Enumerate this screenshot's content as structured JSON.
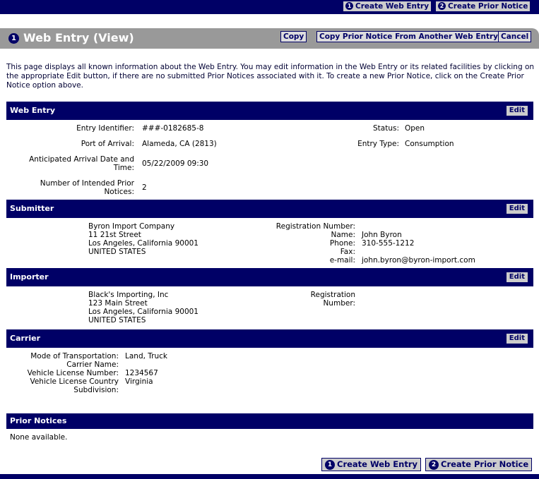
{
  "top_nav": {
    "create_web_entry": "Create Web Entry",
    "create_prior_notice": "Create Prior Notice",
    "step1": "1",
    "step2": "2"
  },
  "header": {
    "step": "1",
    "title": "Web Entry (View)",
    "copy": "Copy",
    "copy_prior_notice": "Copy Prior Notice From Another Web Entry",
    "cancel": "Cancel"
  },
  "intro": "This page displays all known information about the Web Entry. You may edit information in the Web Entry or its related facilities by clicking on the appropriate Edit button, if there are no submitted Prior Notices associated with it. To create a new Prior Notice, click on the Create Prior Notice option above.",
  "edit_label": "Edit",
  "web_entry": {
    "title": "Web Entry",
    "entry_identifier_label": "Entry Identifier:",
    "entry_identifier": "###-0182685-8",
    "status_label": "Status:",
    "status": "Open",
    "port_label": "Port of Arrival:",
    "port": "Alameda, CA (2813)",
    "entry_type_label": "Entry Type:",
    "entry_type": "Consumption",
    "arrival_label_1": "Anticipated Arrival Date and",
    "arrival_label_2": "Time:",
    "arrival": "05/22/2009 09:30",
    "notices_label_1": "Number of Intended Prior",
    "notices_label_2": "Notices:",
    "notices": "2"
  },
  "submitter": {
    "title": "Submitter",
    "address": [
      "Byron Import Company",
      "11 21st Street",
      "Los Angeles, California  90001",
      "UNITED STATES"
    ],
    "labels": [
      "Registration Number:",
      "Name:",
      "Phone:",
      "Fax:",
      "e-mail:"
    ],
    "values": [
      "",
      "John Byron",
      "310-555-1212",
      "",
      "john.byron@byron-import.com"
    ]
  },
  "importer": {
    "title": "Importer",
    "address": [
      "Black's Importing, Inc",
      "123 Main Street",
      "Los Angeles, California  90001",
      "UNITED STATES"
    ],
    "reg_label_1": "Registration",
    "reg_label_2": "Number:"
  },
  "carrier": {
    "title": "Carrier",
    "labels": [
      "Mode of Transportation:",
      "Carrier Name:",
      "Vehicle License Number:",
      "Vehicle License Country",
      "Subdivision:"
    ],
    "values": [
      "Land, Truck",
      "",
      "1234567",
      "Virginia",
      ""
    ]
  },
  "prior_notices": {
    "title": "Prior Notices",
    "empty": "None available."
  },
  "bottom_nav": {
    "create_web_entry": "Create Web Entry",
    "create_prior_notice": "Create Prior Notice",
    "step1": "1",
    "step2": "2"
  }
}
